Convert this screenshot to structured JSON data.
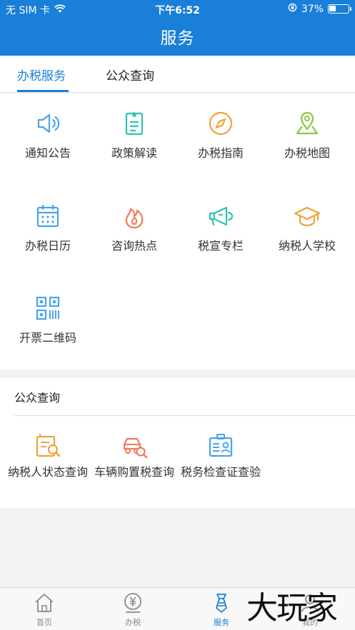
{
  "status_bar": {
    "carrier": "无 SIM 卡",
    "time": "下午6:52",
    "battery": "37%",
    "battery_level": 0.37
  },
  "nav": {
    "title": "服务"
  },
  "tabs": [
    {
      "label": "办税服务",
      "active": true
    },
    {
      "label": "公众查询",
      "active": false
    }
  ],
  "services": [
    {
      "label": "通知公告",
      "icon": "speaker-icon"
    },
    {
      "label": "政策解读",
      "icon": "clipboard-star-icon"
    },
    {
      "label": "办税指南",
      "icon": "compass-icon"
    },
    {
      "label": "办税地图",
      "icon": "map-pin-icon"
    },
    {
      "label": "办税日历",
      "icon": "calendar-icon"
    },
    {
      "label": "咨询热点",
      "icon": "flame-icon"
    },
    {
      "label": "税宣专栏",
      "icon": "megaphone-icon"
    },
    {
      "label": "纳税人学校",
      "icon": "graduation-cap-icon"
    },
    {
      "label": "开票二维码",
      "icon": "qr-code-icon"
    }
  ],
  "public_query": {
    "title": "公众查询",
    "items": [
      {
        "label": "纳税人状态查询",
        "icon": "document-search-icon"
      },
      {
        "label": "车辆购置税查询",
        "icon": "car-search-icon"
      },
      {
        "label": "税务检查证查验",
        "icon": "id-badge-icon"
      }
    ]
  },
  "tabbar": [
    {
      "label": "首页",
      "icon": "home-icon",
      "active": false
    },
    {
      "label": "办税",
      "icon": "yuan-icon",
      "active": false
    },
    {
      "label": "服务",
      "icon": "tie-icon",
      "active": true
    },
    {
      "label": "我的",
      "icon": "user-icon",
      "active": false
    }
  ],
  "watermark": "大玩家",
  "colors": {
    "brand": "#1a7fd9",
    "blue_icon": "#4aa3e8",
    "teal_icon": "#2ec4b0",
    "orange_icon": "#f0a23c",
    "green_icon": "#8cc63f",
    "red_icon": "#f07a5a"
  }
}
